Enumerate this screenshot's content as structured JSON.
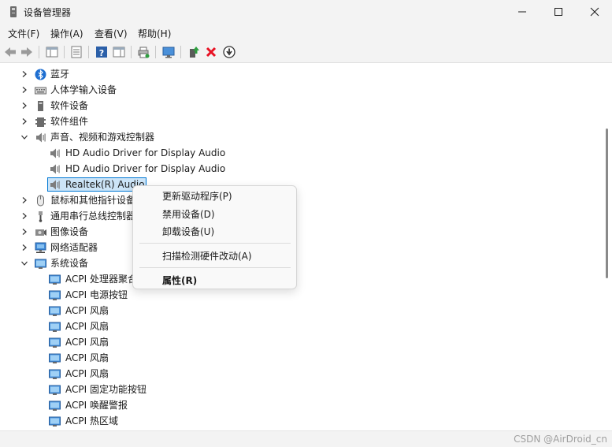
{
  "window": {
    "title": "设备管理器"
  },
  "menu": [
    "文件(F)",
    "操作(A)",
    "查看(V)",
    "帮助(H)"
  ],
  "tree": [
    {
      "label": "蓝牙",
      "icon": "bluetooth-icon",
      "expander": ">"
    },
    {
      "label": "人体学输入设备",
      "icon": "keyboard-icon",
      "expander": ">"
    },
    {
      "label": "软件设备",
      "icon": "device-icon",
      "expander": ">"
    },
    {
      "label": "软件组件",
      "icon": "component-icon",
      "expander": ">"
    },
    {
      "label": "声音、视频和游戏控制器",
      "icon": "speaker-icon",
      "expander": "v"
    },
    {
      "label": "HD Audio Driver for Display Audio",
      "icon": "speaker-icon",
      "expander": ""
    },
    {
      "label": "HD Audio Driver for Display Audio",
      "icon": "speaker-icon",
      "expander": ""
    },
    {
      "label": "Realtek(R) Audio",
      "icon": "speaker-icon",
      "expander": "",
      "selected": true
    },
    {
      "label": "鼠标和其他指针设备",
      "icon": "mouse-icon",
      "expander": ">"
    },
    {
      "label": "通用串行总线控制器",
      "icon": "usb-icon",
      "expander": ">"
    },
    {
      "label": "图像设备",
      "icon": "camera-icon",
      "expander": ">"
    },
    {
      "label": "网络适配器",
      "icon": "network-icon",
      "expander": ">"
    },
    {
      "label": "系统设备",
      "icon": "system-folder-icon",
      "expander": "v"
    },
    {
      "label": "ACPI 处理器聚合",
      "icon": "system-device-icon",
      "expander": ""
    },
    {
      "label": "ACPI 电源按钮",
      "icon": "system-device-icon",
      "expander": ""
    },
    {
      "label": "ACPI 风扇",
      "icon": "system-device-icon",
      "expander": ""
    },
    {
      "label": "ACPI 风扇",
      "icon": "system-device-icon",
      "expander": ""
    },
    {
      "label": "ACPI 风扇",
      "icon": "system-device-icon",
      "expander": ""
    },
    {
      "label": "ACPI 风扇",
      "icon": "system-device-icon",
      "expander": ""
    },
    {
      "label": "ACPI 风扇",
      "icon": "system-device-icon",
      "expander": ""
    },
    {
      "label": "ACPI 固定功能按钮",
      "icon": "system-device-icon",
      "expander": ""
    },
    {
      "label": "ACPI 唤醒警报",
      "icon": "system-device-icon",
      "expander": ""
    },
    {
      "label": "ACPI 热区域",
      "icon": "system-device-icon",
      "expander": ""
    }
  ],
  "context_menu": [
    "更新驱动程序(P)",
    "禁用设备(D)",
    "卸载设备(U)",
    "扫描检测硬件改动(A)",
    "属性(R)"
  ],
  "watermark": "CSDN @AirDroid_cn",
  "colors": {
    "selection_bg": "#cce4f7",
    "selection_border": "#0078d4",
    "delete_red": "#e81123"
  }
}
